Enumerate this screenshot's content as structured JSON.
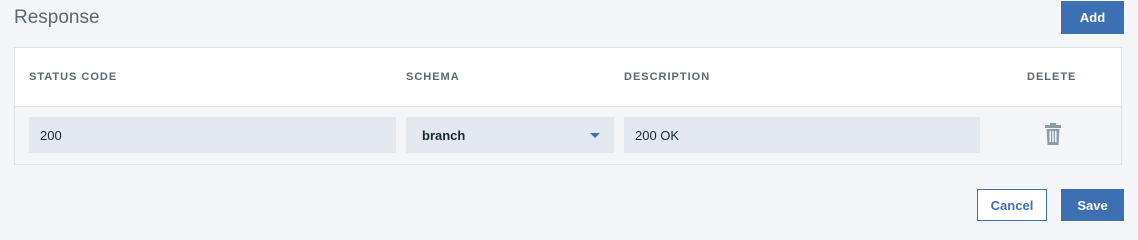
{
  "section": {
    "title": "Response"
  },
  "toolbar": {
    "add_label": "Add"
  },
  "table": {
    "headers": {
      "status_code": "STATUS CODE",
      "schema": "SCHEMA",
      "description": "DESCRIPTION",
      "delete": "DELETE"
    },
    "rows": [
      {
        "status_code": "200",
        "schema": "branch",
        "description": "200 OK",
        "delete_icon": "trash-icon"
      }
    ]
  },
  "footer": {
    "cancel_label": "Cancel",
    "save_label": "Save"
  },
  "colors": {
    "primary": "#3d70b2",
    "field_bg": "#e3e7ee",
    "page_bg": "#f4f5f9",
    "header_text": "#5a6872"
  }
}
